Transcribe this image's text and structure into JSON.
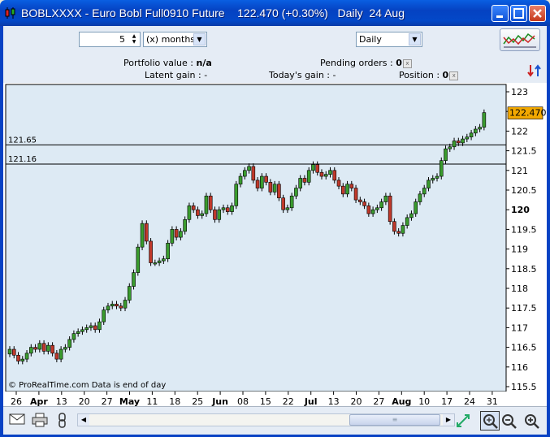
{
  "window": {
    "title": "BOBLXXXX - Euro Bobl Full0910 Future    122.470 (+0.30%)   Daily  24 Aug"
  },
  "toolbar": {
    "period_value": "5",
    "period_unit": "(x) months",
    "interval": "Daily"
  },
  "portfolio": {
    "portfolio_value_label": "Portfolio value : ",
    "portfolio_value": "n/a",
    "pending_orders_label": "Pending orders : ",
    "pending_orders": "0",
    "latent_gain_label": "Latent gain : ",
    "latent_gain": "-",
    "todays_gain_label": "Today's gain : ",
    "todays_gain": "-",
    "position_label": "Position : ",
    "position": "0"
  },
  "chart": {
    "watermark": "© ProRealTime.com  Data is end of day",
    "last_price_label": "122.470",
    "hlines": [
      {
        "label": "121.65",
        "value": 121.65
      },
      {
        "label": "121.16",
        "value": 121.16
      }
    ]
  },
  "chart_data": {
    "type": "candlestick",
    "ylim": [
      115.5,
      123
    ],
    "yticks": [
      115.5,
      116,
      116.5,
      117,
      117.5,
      118,
      118.5,
      119,
      119.5,
      120,
      120.5,
      121,
      121.5,
      122,
      122.5,
      123
    ],
    "ytick_labels": [
      "115.5",
      "116",
      "116.5",
      "117",
      "117.5",
      "118",
      "118.5",
      "119",
      "119.5",
      "120",
      "120.5",
      "121",
      "121.5",
      "122",
      "",
      "123"
    ],
    "xtick_labels": [
      "26",
      "Apr",
      "13",
      "20",
      "27",
      "May",
      "11",
      "18",
      "25",
      "Jun",
      "08",
      "15",
      "22",
      "Jul",
      "13",
      "20",
      "27",
      "Aug",
      "10",
      "17",
      "24",
      "31"
    ],
    "bold_xtick_labels": [
      "Apr",
      "May",
      "Jun",
      "Jul",
      "Aug"
    ],
    "colors": {
      "up": "#3a9c2e",
      "down": "#c0392b",
      "background": "#ddeaf4"
    },
    "closes": [
      116.45,
      116.3,
      116.15,
      116.2,
      116.35,
      116.5,
      116.45,
      116.6,
      116.4,
      116.55,
      116.35,
      116.2,
      116.45,
      116.5,
      116.7,
      116.85,
      116.9,
      116.95,
      117.0,
      117.05,
      116.95,
      117.15,
      117.45,
      117.55,
      117.6,
      117.55,
      117.5,
      117.7,
      118.05,
      118.4,
      119.05,
      119.65,
      119.2,
      118.65,
      118.65,
      118.7,
      118.75,
      119.15,
      119.5,
      119.3,
      119.45,
      119.75,
      120.1,
      120.0,
      119.85,
      119.9,
      120.35,
      120.0,
      119.75,
      120.0,
      120.05,
      119.95,
      120.1,
      120.65,
      120.85,
      121.0,
      121.1,
      120.75,
      120.55,
      120.85,
      120.7,
      120.45,
      120.65,
      120.3,
      120.0,
      120.05,
      120.35,
      120.55,
      120.8,
      120.7,
      121.0,
      121.15,
      120.95,
      120.85,
      120.9,
      121.0,
      120.75,
      120.6,
      120.4,
      120.65,
      120.55,
      120.25,
      120.2,
      120.1,
      119.9,
      120.0,
      120.05,
      120.2,
      120.35,
      119.7,
      119.45,
      119.4,
      119.6,
      119.8,
      119.9,
      120.2,
      120.4,
      120.55,
      120.75,
      120.8,
      120.85,
      121.25,
      121.55,
      121.6,
      121.75,
      121.7,
      121.8,
      121.85,
      121.95,
      122.05,
      122.1,
      122.47
    ]
  }
}
